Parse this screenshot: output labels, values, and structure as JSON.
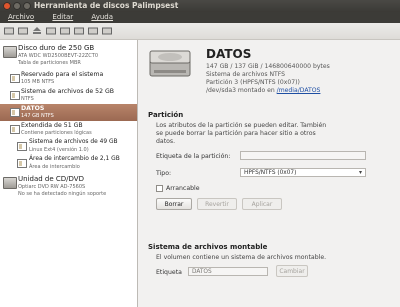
{
  "window": {
    "title": "Herramienta de discos Palimpsest"
  },
  "menu": [
    "Archivo",
    "Editar",
    "Ayuda"
  ],
  "tree": {
    "hdd": {
      "title": "Disco duro de 250 GB",
      "sub1": "ATA WDC WD2500BEVT-22ZCT0",
      "sub2": "Tabla de particiones MBR"
    },
    "partitions": [
      {
        "title": "Reservado para el sistema",
        "sub": "105 MB NTFS"
      },
      {
        "title": "Sistema de archivos de 52 GB",
        "sub": "NTFS"
      },
      {
        "title": "DATOS",
        "sub": "147 GB NTFS"
      },
      {
        "title": "Extendida de 51 GB",
        "sub": "Contiene particiones lógicas"
      },
      {
        "title": "Sistema de archivos de 49 GB",
        "sub": "Linux Ext4 (versión 1.0)"
      },
      {
        "title": "Área de intercambio de 2,1 GB",
        "sub": "Área de intercambio"
      }
    ],
    "cd": {
      "title": "Unidad de CD/DVD",
      "sub1": "Optiarc DVD RW AD-7560S",
      "sub2": "No se ha detectado ningún soporte"
    }
  },
  "detail": {
    "name": "DATOS",
    "line1": "147 GB / 137 GiB / 146800640000 bytes",
    "line2": "Sistema de archivos NTFS",
    "line3": "Partición 3 (HPFS/NTFS (0x07))",
    "line4_prefix": "/dev/sda3 montado en",
    "line4_link": "/media/DATOS"
  },
  "partition_section": {
    "title": "Partición",
    "desc1": "Los atributos de la partición se pueden editar. También",
    "desc2": "se puede borrar la partición para hacer sitio a otros",
    "desc3": "datos.",
    "label_field": "Etiqueta de la partición:",
    "type_label": "Tipo:",
    "type_value": "HPFS/NTFS (0x07)",
    "bootable": "Arrancable",
    "btn_delete": "Borrar",
    "btn_revert": "Revertir",
    "btn_apply": "Aplicar"
  },
  "fs_section": {
    "title": "Sistema de archivos montable",
    "desc": "El volumen contiene un sistema de archivos montable.",
    "label": "Etiqueta",
    "value": "DATOS",
    "btn_change": "Cambiar"
  }
}
